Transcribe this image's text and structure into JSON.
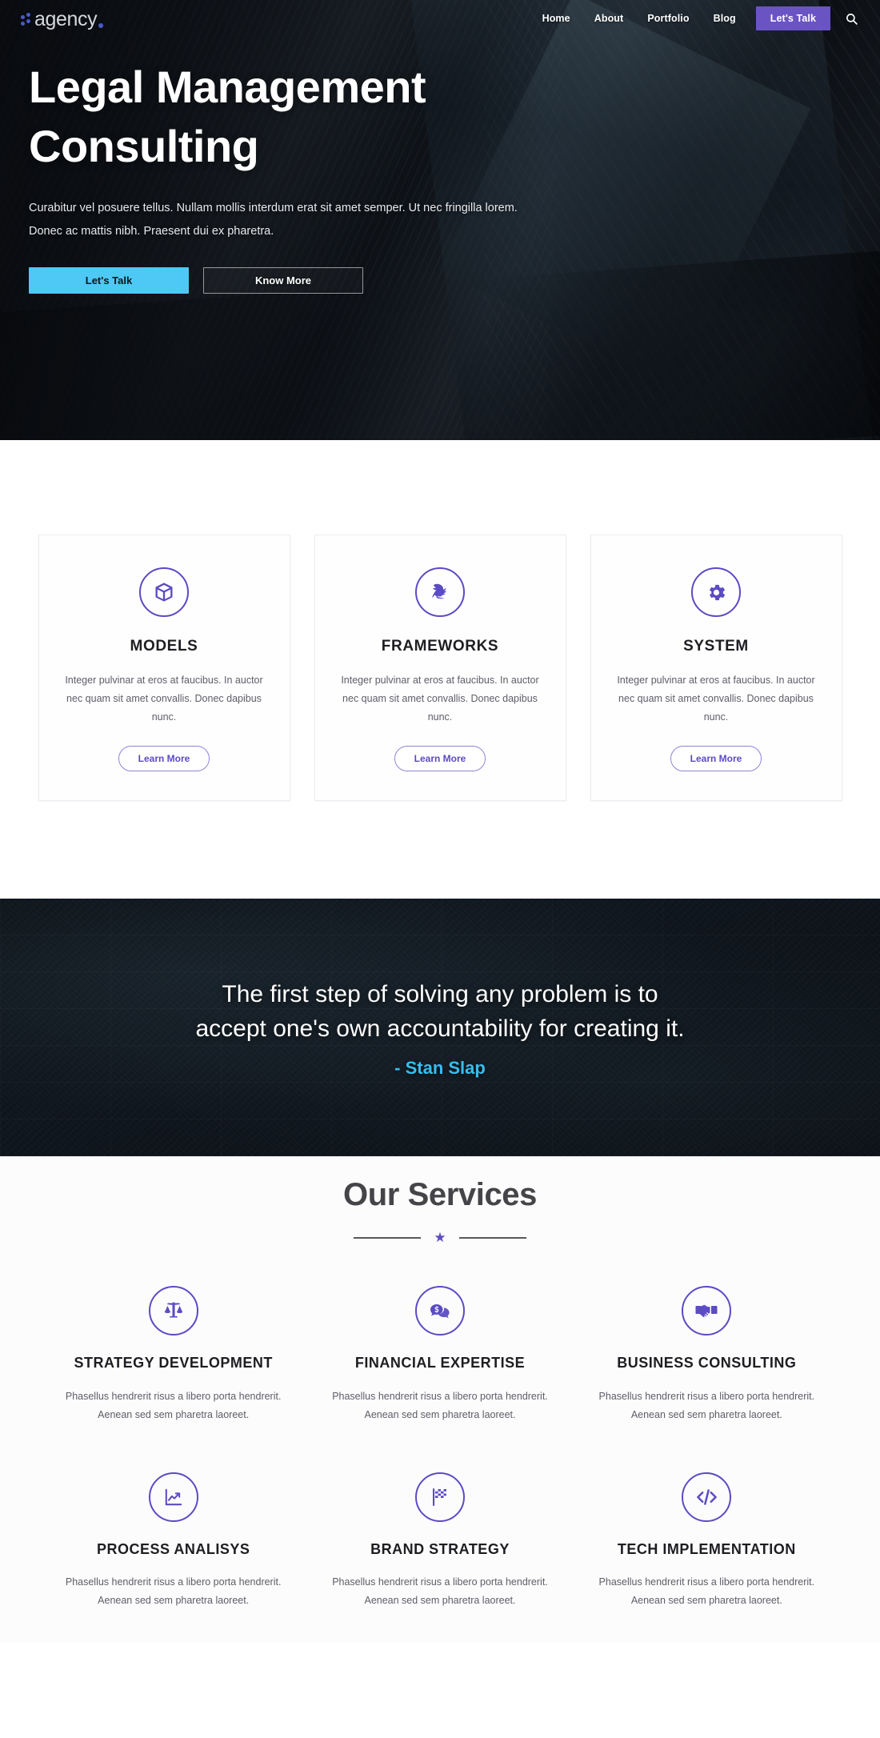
{
  "brand": {
    "name": "agency",
    "accent_purple": "#5b4bc4",
    "accent_cyan": "#4ec8f4",
    "nav_cta_purple": "#6a54c4"
  },
  "nav": {
    "items": [
      {
        "label": "Home"
      },
      {
        "label": "About"
      },
      {
        "label": "Portfolio"
      },
      {
        "label": "Blog"
      }
    ],
    "cta_label": "Let's Talk",
    "search_icon": "search-icon"
  },
  "hero": {
    "title": "Legal Management Consulting",
    "subtitle": "Curabitur vel posuere tellus. Nullam mollis interdum erat sit amet semper. Ut nec fringilla lorem. Donec ac mattis nibh. Praesent dui ex pharetra.",
    "primary_button": "Let's Talk",
    "secondary_button": "Know More"
  },
  "features": {
    "body_text": "Integer pulvinar at eros at faucibus. In auctor nec quam sit amet convallis. Donec dapibus nunc.",
    "learn_more_label": "Learn More",
    "cards": [
      {
        "title": "MODELS",
        "icon": "cube-box-icon"
      },
      {
        "title": "FRAMEWORKS",
        "icon": "bird-feather-icon"
      },
      {
        "title": "SYSTEM",
        "icon": "gear-icon"
      }
    ]
  },
  "quote": {
    "text": "The first step of solving any problem is to accept one's own accountability for creating it.",
    "author": "- Stan Slap"
  },
  "services": {
    "heading": "Our Services",
    "divider_icon": "star-icon",
    "body_text": "Phasellus hendrerit risus a libero porta hendrerit. Aenean sed sem pharetra laoreet.",
    "items": [
      {
        "title": "STRATEGY DEVELOPMENT",
        "icon": "scales-balance-icon"
      },
      {
        "title": "FINANCIAL EXPERTISE",
        "icon": "dollar-chat-bubble-icon"
      },
      {
        "title": "BUSINESS CONSULTING",
        "icon": "handshake-icon"
      },
      {
        "title": "PROCESS ANALISYS",
        "icon": "line-chart-icon"
      },
      {
        "title": "BRAND STRATEGY",
        "icon": "checkered-flag-icon"
      },
      {
        "title": "TECH IMPLEMENTATION",
        "icon": "code-brackets-icon"
      }
    ]
  }
}
